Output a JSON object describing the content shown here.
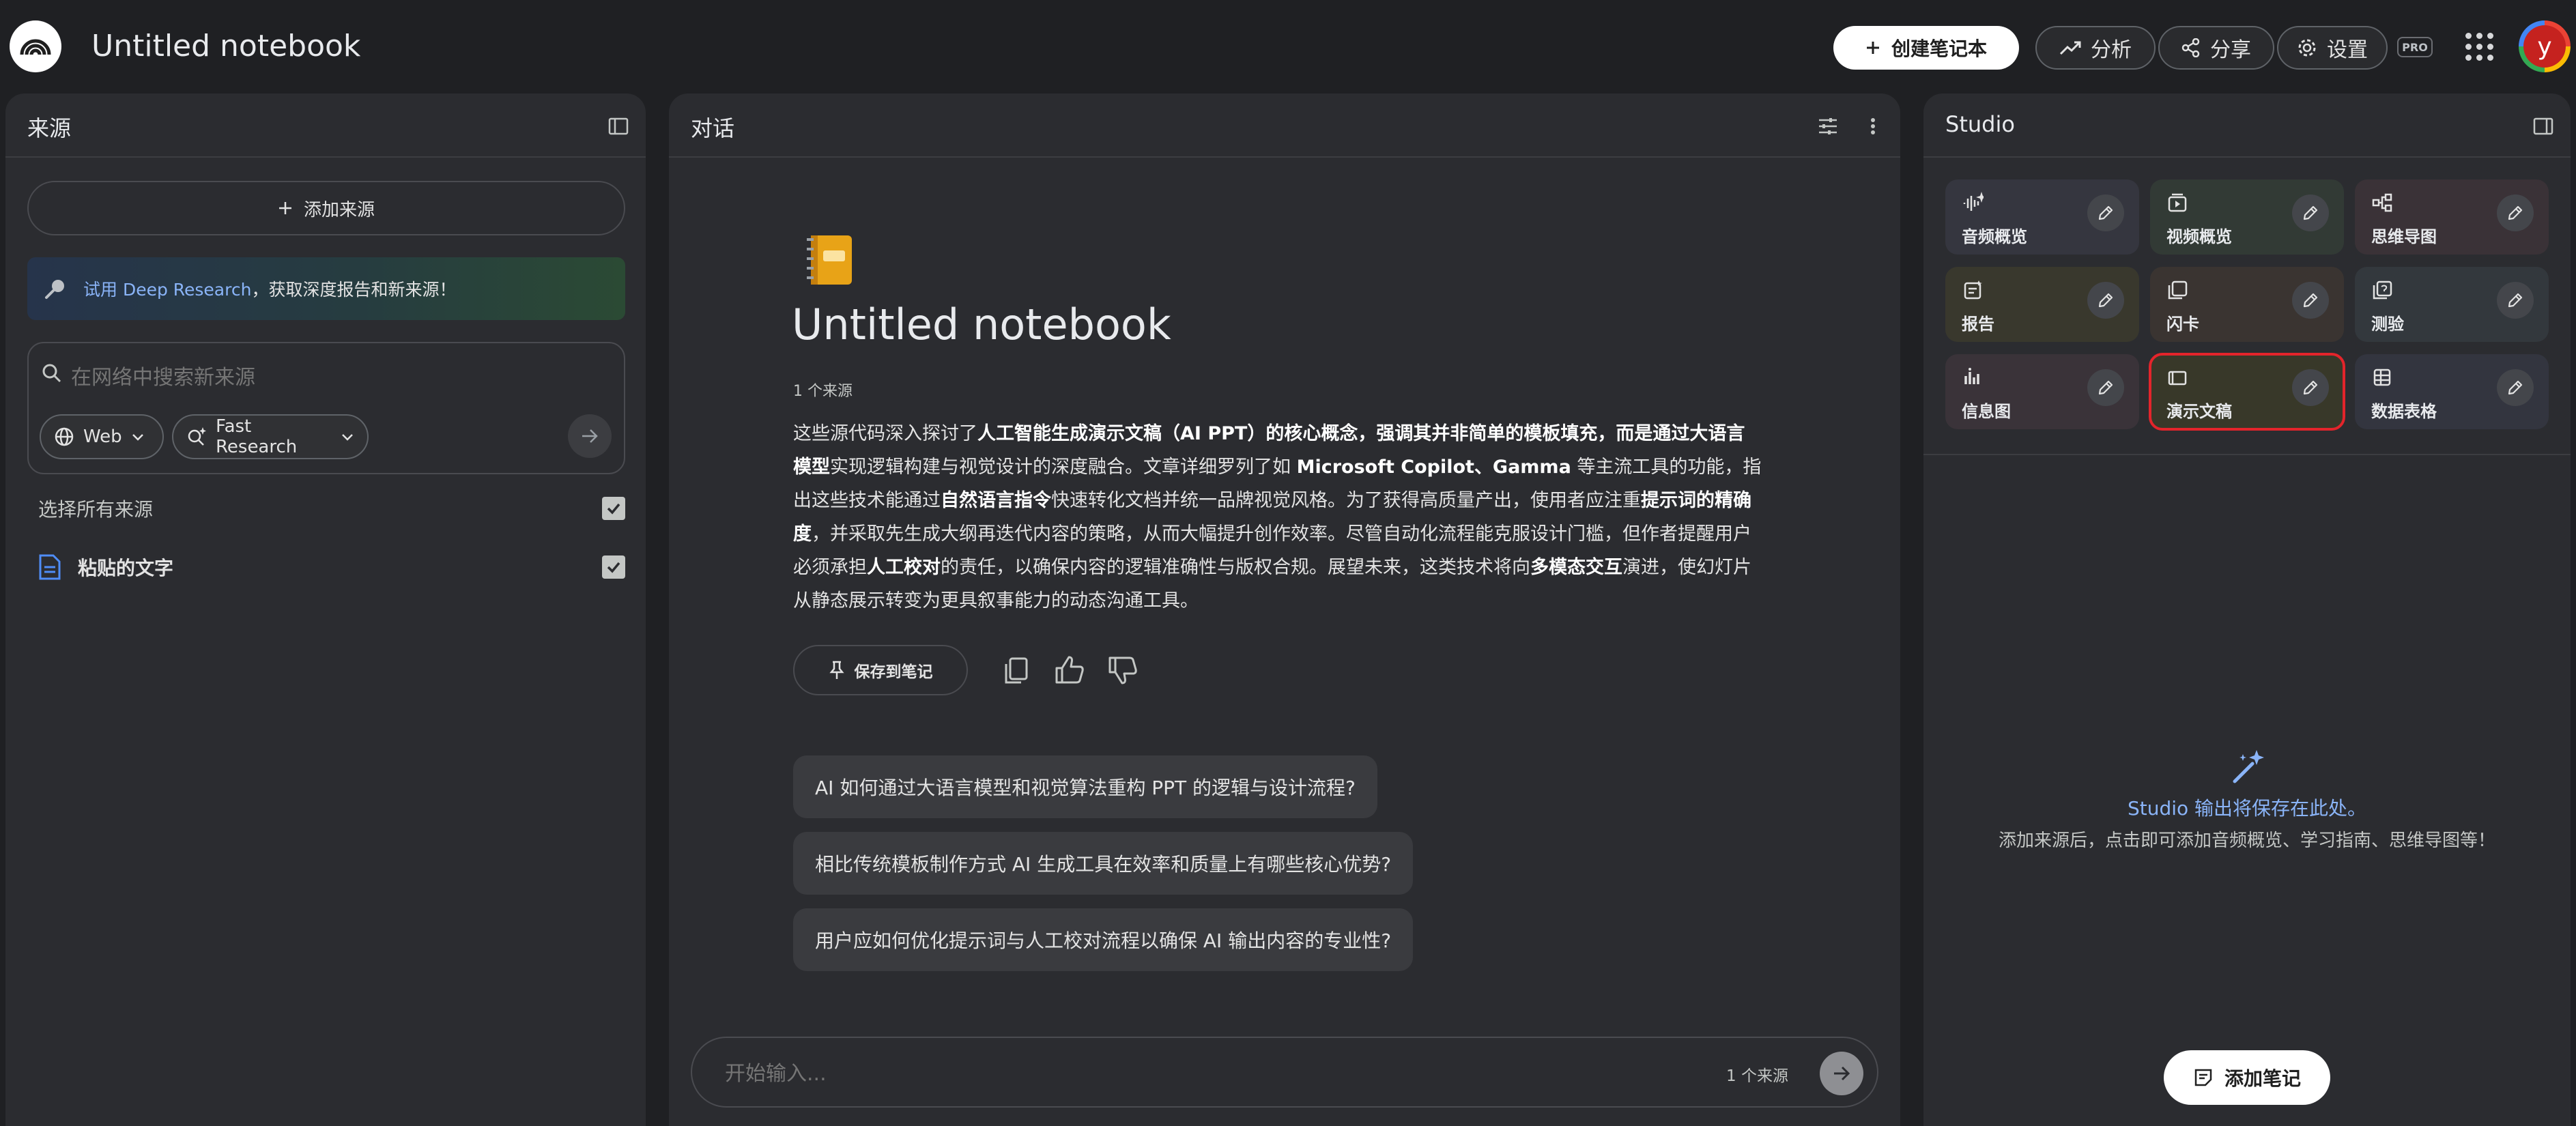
{
  "app": {
    "title": "Untitled notebook",
    "logo": "notebooklm-logo"
  },
  "top_actions": {
    "create_label": "创建笔记本",
    "analytics_label": "分析",
    "share_label": "分享",
    "settings_label": "设置",
    "pro_badge": "PRO",
    "avatar_letter": "y"
  },
  "sources": {
    "title": "来源",
    "add_source_label": "添加来源",
    "deep_research_link": "试用 Deep Research",
    "deep_research_text": "，获取深度报告和新来源！",
    "search_placeholder": "在网络中搜索新来源",
    "chip_web": "Web",
    "chip_fast": "Fast Research",
    "select_all_label": "选择所有来源",
    "items": [
      {
        "label": "粘贴的文字",
        "checked": true
      }
    ]
  },
  "chat": {
    "title": "对话",
    "notebook_title": "Untitled notebook",
    "source_count": "1 个来源",
    "summary_parts": [
      {
        "t": "这些源代码深入探讨了",
        "b": false
      },
      {
        "t": "人工智能生成演示文稿（AI PPT）的核心概念，强调其并非简单的模板填充，而是通过大语言模型",
        "b": true
      },
      {
        "t": "实现逻辑构建与视觉设计的深度融合。文章详细罗列了如 ",
        "b": false
      },
      {
        "t": "Microsoft Copilot、Gamma",
        "b": true
      },
      {
        "t": " 等主流工具的功能，指出这些技术能通过",
        "b": false
      },
      {
        "t": "自然语言指令",
        "b": true
      },
      {
        "t": "快速转化文档并统一品牌视觉风格。为了获得高质量产出，使用者应注重",
        "b": false
      },
      {
        "t": "提示词的精确度",
        "b": true
      },
      {
        "t": "，并采取先生成大纲再迭代内容的策略，从而大幅提升创作效率。尽管自动化流程能克服设计门槛，但作者提醒用户必须承担",
        "b": false
      },
      {
        "t": "人工校对",
        "b": true
      },
      {
        "t": "的责任，以确保内容的逻辑准确性与版权合规。展望未来，这类技术将向",
        "b": false
      },
      {
        "t": "多模态交互",
        "b": true
      },
      {
        "t": "演进，使幻灯片从静态展示转变为更具叙事能力的动态沟通工具。",
        "b": false
      }
    ],
    "save_to_note_label": "保存到笔记",
    "suggestions": [
      "AI 如何通过大语言模型和视觉算法重构 PPT 的逻辑与设计流程?",
      "相比传统模板制作方式 AI 生成工具在效率和质量上有哪些核心优势?",
      "用户应如何优化提示词与人工校对流程以确保 AI 输出内容的专业性?"
    ],
    "input_placeholder": "开始输入...",
    "input_source_count": "1 个来源"
  },
  "studio": {
    "title": "Studio",
    "tiles": [
      {
        "label": "音频概览",
        "icon": "audio-wave-icon",
        "bg": "#35363f"
      },
      {
        "label": "视频概览",
        "icon": "video-icon",
        "bg": "#323a35"
      },
      {
        "label": "思维导图",
        "icon": "mindmap-icon",
        "bg": "#3a3237"
      },
      {
        "label": "报告",
        "icon": "report-icon",
        "bg": "#39382d"
      },
      {
        "label": "闪卡",
        "icon": "flashcard-icon",
        "bg": "#3a3431"
      },
      {
        "label": "测验",
        "icon": "quiz-icon",
        "bg": "#33383d"
      },
      {
        "label": "信息图",
        "icon": "infographic-icon",
        "bg": "#3a3339"
      },
      {
        "label": "演示文稿",
        "icon": "slides-icon",
        "bg": "#383829",
        "highlighted": true
      },
      {
        "label": "数据表格",
        "icon": "table-icon",
        "bg": "#33353f"
      }
    ],
    "empty_title": "Studio 输出将保存在此处。",
    "empty_desc": "添加来源后，点击即可添加音频概览、学习指南、思维导图等！",
    "add_note_label": "添加笔记"
  },
  "colors": {
    "background": "#1f2023",
    "panel": "#2b2c30",
    "accent_link": "#8ab4f8",
    "highlight_border": "#e3242b"
  }
}
